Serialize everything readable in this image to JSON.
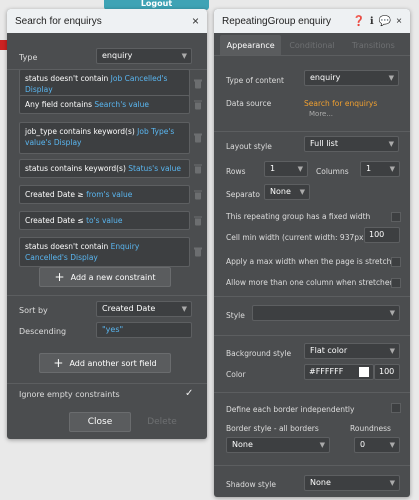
{
  "background": {
    "logout": "Logout"
  },
  "search_panel": {
    "title": "Search for enquirys",
    "type_label": "Type",
    "type_value": "enquiry",
    "constraints": [
      {
        "prefix": "status doesn't contain",
        "value": "Job Cancelled's Display"
      },
      {
        "prefix": "Any field contains",
        "value": "Search's value"
      },
      {
        "prefix": "job_type contains keyword(s)",
        "value": "Job Type's value's Display"
      },
      {
        "prefix": "status contains keyword(s)",
        "value": "Status's value"
      },
      {
        "prefix": "Created Date ≥",
        "value": "from's value"
      },
      {
        "prefix": "Created Date ≤",
        "value": "to's value"
      },
      {
        "prefix": "status doesn't contain",
        "value": "Enquiry Cancelled's Display"
      }
    ],
    "add_constraint": "Add a new constraint",
    "sort_by_label": "Sort by",
    "sort_by_value": "Created Date",
    "descending_label": "Descending",
    "descending_value": "\"yes\"",
    "add_sort": "Add another sort field",
    "ignore_empty": "Ignore empty constraints",
    "close": "Close",
    "delete": "Delete"
  },
  "rg_panel": {
    "title": "RepeatingGroup enquiry",
    "tabs": [
      "Appearance",
      "Conditional",
      "Transitions"
    ],
    "type_of_content_label": "Type of content",
    "type_of_content_value": "enquiry",
    "data_source_label": "Data source",
    "data_source_value": "Search for enquirys",
    "more": "More...",
    "layout_style_label": "Layout style",
    "layout_style_value": "Full list",
    "rows_label": "Rows",
    "rows_value": "1",
    "columns_label": "Columns",
    "columns_value": "1",
    "separator_label": "Separato",
    "separator_value": "None",
    "fixed_width": "This repeating group has a fixed width",
    "cell_min_width_label": "Cell min width (current width: 937px)",
    "cell_min_width_value": "100",
    "max_width": "Apply a max width when the page is stretched",
    "multi_column": "Allow more than one column when stretched",
    "style_label": "Style",
    "bg_style_label": "Background style",
    "bg_style_value": "Flat color",
    "color_label": "Color",
    "color_hex": "#FFFFFF",
    "color_opacity": "100",
    "each_border": "Define each border independently",
    "border_style_label": "Border style - all borders",
    "border_style_value": "None",
    "roundness_label": "Roundness",
    "roundness_value": "0",
    "shadow_label": "Shadow style",
    "shadow_value": "None"
  },
  "colors": {
    "panel": "#4b4d4f",
    "header": "#eef1f3",
    "link": "#5ab6f0",
    "orange": "#f0a030",
    "logout": "#3ea3b5"
  }
}
